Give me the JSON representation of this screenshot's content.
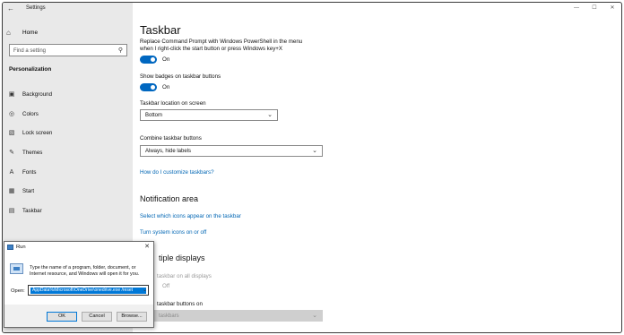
{
  "window": {
    "app_title": "Settings",
    "back_icon": "back-arrow-icon",
    "controls": [
      "minimize",
      "maximize",
      "close"
    ],
    "control_glyphs": [
      "—",
      "☐",
      "✕"
    ]
  },
  "sidebar": {
    "home_label": "Home",
    "search_placeholder": "Find a setting",
    "section_title": "Personalization",
    "items": [
      {
        "label": "Background",
        "icon": "background-icon"
      },
      {
        "label": "Colors",
        "icon": "colors-icon"
      },
      {
        "label": "Lock screen",
        "icon": "lock-screen-icon"
      },
      {
        "label": "Themes",
        "icon": "themes-icon"
      },
      {
        "label": "Fonts",
        "icon": "fonts-icon"
      },
      {
        "label": "Start",
        "icon": "start-icon"
      },
      {
        "label": "Taskbar",
        "icon": "taskbar-icon"
      }
    ]
  },
  "main": {
    "title": "Taskbar",
    "replace_cmd_text_1": "Replace Command Prompt with Windows PowerShell in the menu",
    "replace_cmd_text_2": "when I right-click the start button or press Windows key+X",
    "replace_cmd_toggle": "On",
    "badges_label": "Show badges on taskbar buttons",
    "badges_toggle": "On",
    "location_label": "Taskbar location on screen",
    "location_value": "Bottom",
    "combine_label": "Combine taskbar buttons",
    "combine_value": "Always, hide labels",
    "customize_link": "How do I customize taskbars?",
    "notification_heading": "Notification area",
    "select_icons_link": "Select which icons appear on the taskbar",
    "system_icons_link": "Turn system icons on or off",
    "multiple_heading": "tiple displays",
    "show_all_displays": "taskbar on all displays",
    "show_all_toggle": "Off",
    "show_buttons_on": "taskbar buttons on",
    "show_buttons_value": "taskbars"
  },
  "run_dialog": {
    "title": "Run",
    "close_glyph": "✕",
    "description": "Type the name of a program, folder, document, or Internet resource, and Windows will open it for you.",
    "open_label": "Open:",
    "open_value": "AppData%\\Microsoft\\OneDrive\\onedrive.exe /reset",
    "ok_label": "OK",
    "cancel_label": "Cancel",
    "browse_label": "Browse..."
  }
}
